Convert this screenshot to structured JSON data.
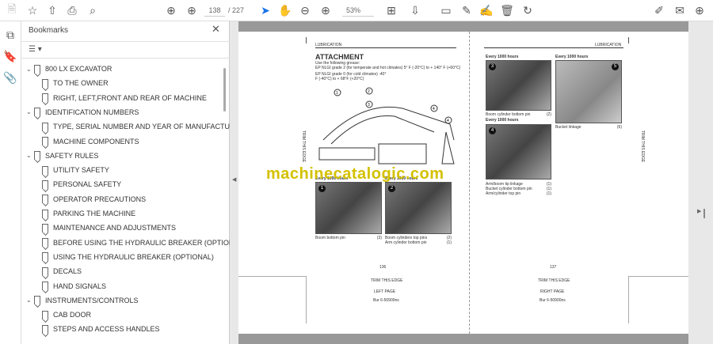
{
  "toolbar": {
    "page_current": "138",
    "page_total": "/ 227",
    "zoom": "53%"
  },
  "bookmarks": {
    "title": "Bookmarks",
    "items": [
      {
        "label": "800 LX EXCAVATOR",
        "level": 0,
        "expanded": true
      },
      {
        "label": "TO THE OWNER",
        "level": 1
      },
      {
        "label": "RIGHT, LEFT,FRONT AND REAR OF MACHINE",
        "level": 1
      },
      {
        "label": "IDENTIFICATION NUMBERS",
        "level": 0,
        "expanded": true
      },
      {
        "label": "TYPE, SERIAL NUMBER AND YEAR OF MANUFACTURE",
        "level": 1
      },
      {
        "label": "MACHINE COMPONENTS",
        "level": 1
      },
      {
        "label": "SAFETY RULES",
        "level": 0,
        "expanded": true
      },
      {
        "label": "UTILITY SAFETY",
        "level": 1
      },
      {
        "label": "PERSONAL SAFETY",
        "level": 1
      },
      {
        "label": "OPERATOR PRECAUTIONS",
        "level": 1
      },
      {
        "label": "PARKING THE MACHINE",
        "level": 1
      },
      {
        "label": "MAINTENANCE AND ADJUSTMENTS",
        "level": 1
      },
      {
        "label": "BEFORE USING THE HYDRAULIC BREAKER (OPTIONAL)",
        "level": 1
      },
      {
        "label": "USING THE HYDRAULIC BREAKER (OPTIONAL)",
        "level": 1
      },
      {
        "label": "DECALS",
        "level": 1
      },
      {
        "label": "HAND SIGNALS",
        "level": 1
      },
      {
        "label": "INSTRUMENTS/CONTROLS",
        "level": 0,
        "expanded": true
      },
      {
        "label": "CAB DOOR",
        "level": 1
      },
      {
        "label": "STEPS AND ACCESS HANDLES",
        "level": 1
      }
    ]
  },
  "document": {
    "watermark": "machinecatalogic.com",
    "left": {
      "header": "LUBRICATION",
      "title": "ATTACHMENT",
      "intro": "Use the following grease:",
      "grease1": "EP NLGI grade 2 (for temperate and hot climates) 5° F (-20°C) to + 140° F (+60°C)",
      "grease2a": "EP NLGI grade 0 (for cold climates) -40°",
      "grease2b": "F (-40°C) to + 68°F (+20°C)",
      "diagram_callouts": [
        "1",
        "2",
        "3",
        "4",
        "4"
      ],
      "photos": [
        {
          "num": "1",
          "heading": "Every 1000 hours",
          "captions": [
            [
              "Boom bottom pin",
              "(3)"
            ]
          ]
        },
        {
          "num": "2",
          "heading": "Every 1000 hours",
          "captions": [
            [
              "Boom cylinders top pins",
              "(2)"
            ],
            [
              "Arm cylinder bottom pin",
              "(1)"
            ]
          ]
        }
      ],
      "page_number": "136",
      "trim": "TRIM THIS EDGE",
      "side": "LEFT PAGE",
      "code": "Bur 6-50900ns",
      "vertical": "TRIM THIS EDGE"
    },
    "right": {
      "header": "LUBRICATION",
      "photos": [
        {
          "num": "3",
          "heading": "Every 1000 hours",
          "captions": [
            [
              "Boom cylinder bottom pin",
              "(2)"
            ]
          ]
        },
        {
          "num": "5",
          "heading": "Every 1000 hours",
          "captions": [
            [
              "Bucket linkage",
              "(6)"
            ]
          ]
        },
        {
          "num": "4",
          "heading": "Every 1000 hours",
          "captions": [
            [
              "Arm/boom tip linkage",
              "(1)"
            ],
            [
              "Bucket cylinder bottom pin",
              "(1)"
            ],
            [
              "Arm/cylinder top pin",
              "(1)"
            ]
          ]
        }
      ],
      "page_number": "137",
      "trim": "TRIM THIS EDGE",
      "side": "RIGHT PAGE",
      "code": "Bur 6-50900ns",
      "vertical": "TRIM THIS EDGE"
    }
  }
}
